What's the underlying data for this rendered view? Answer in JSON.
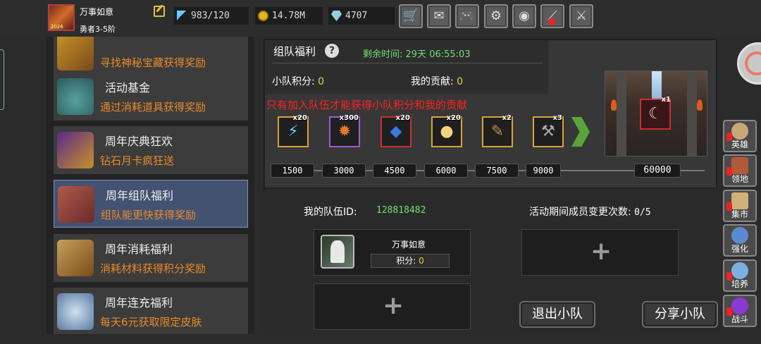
{
  "player": {
    "name": "万事如意",
    "rank": "勇者3-5阶",
    "avatar_tag": "2026"
  },
  "resources": {
    "energy": "983/120",
    "coins": "14.78M",
    "gems": "4707"
  },
  "toolbar_icons": [
    "cart-icon",
    "mail-icon",
    "gamepad-icon",
    "gear-icon",
    "color-wheel-icon",
    "broom-icon",
    "crossed-swords-icon"
  ],
  "sidebar": {
    "items": [
      {
        "title": "",
        "desc": "寻找神秘宝藏获得奖励"
      },
      {
        "title": "活动基金",
        "desc": "通过消耗道具获得奖励"
      },
      {
        "title": "周年庆典狂欢",
        "desc": "钻石月卡疯狂送"
      },
      {
        "title": "周年组队福利",
        "desc": "组队能更快获得奖励"
      },
      {
        "title": "周年消耗福利",
        "desc": "消耗材料获得积分奖励"
      },
      {
        "title": "周年连充福利",
        "desc": "每天6元获取限定皮肤"
      }
    ]
  },
  "team_panel": {
    "title": "组队福利",
    "remaining_label": "剩余时间:",
    "remaining_value": "29天  06:55:03",
    "team_points_label": "小队积分:",
    "team_points": "0",
    "my_contrib_label": "我的贡献:",
    "my_contrib": "0",
    "warning": "只有加入队伍才能获得小队积分和我的贡献"
  },
  "rewards": [
    {
      "qty": "x20",
      "icon": "lightning-icon",
      "color": "#6cf"
    },
    {
      "qty": "x300",
      "icon": "fire-orb-icon",
      "color": "#e87a2a"
    },
    {
      "qty": "x20",
      "icon": "blue-gem-icon",
      "color": "#3a7adf"
    },
    {
      "qty": "x20",
      "icon": "egg-icon",
      "color": "#f2d27a"
    },
    {
      "qty": "x2",
      "icon": "scroll-icon",
      "color": "#c88a4a"
    },
    {
      "qty": "x3",
      "icon": "hammer-icon",
      "color": "#aaa"
    }
  ],
  "final_reward": {
    "qty": "x1",
    "icon": "skin-card-icon"
  },
  "milestones": [
    "1500",
    "3000",
    "4500",
    "6000",
    "7500",
    "9000",
    "60000"
  ],
  "team": {
    "id_label": "我的队伍ID:",
    "id_value": "128818482",
    "change_label": "活动期间成员变更次数:",
    "change_value": "0/5",
    "member_name": "万事如意",
    "member_score_label": "积分:",
    "member_score": "0",
    "add_symbol": "+"
  },
  "buttons": {
    "leave": "退出小队",
    "share": "分享小队"
  },
  "right_nav": [
    {
      "label": "英雄",
      "icon": "helmet-icon",
      "color": "#c8a87a"
    },
    {
      "label": "领地",
      "icon": "castle-icon",
      "color": "#b05a3a"
    },
    {
      "label": "集市",
      "icon": "market-icon",
      "color": "#d2b07a"
    },
    {
      "label": "强化",
      "icon": "shield-icon",
      "color": "#5a8ad2"
    },
    {
      "label": "培养",
      "icon": "potion-icon",
      "color": "#7ab0e0"
    },
    {
      "label": "战斗",
      "icon": "portal-icon",
      "color": "#8a3ad2"
    }
  ]
}
